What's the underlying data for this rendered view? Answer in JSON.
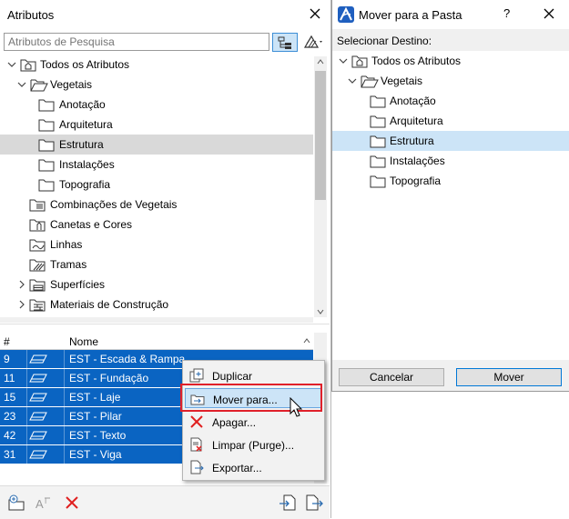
{
  "left_panel": {
    "title": "Atributos",
    "search": {
      "placeholder": "Atributos de Pesquisa",
      "value": ""
    },
    "tree": [
      {
        "label": "Todos os Atributos",
        "depth": 0,
        "expanded": true,
        "icon": "home-folder-icon"
      },
      {
        "label": "Vegetais",
        "depth": 1,
        "expanded": true,
        "icon": "open-folder-icon"
      },
      {
        "label": "Anotação",
        "depth": 2,
        "icon": "folder-icon"
      },
      {
        "label": "Arquitetura",
        "depth": 2,
        "icon": "folder-icon"
      },
      {
        "label": "Estrutura",
        "depth": 2,
        "icon": "folder-icon",
        "selected": true
      },
      {
        "label": "Instalações",
        "depth": 2,
        "icon": "folder-icon"
      },
      {
        "label": "Topografia",
        "depth": 2,
        "icon": "folder-icon"
      },
      {
        "label": "Combinações de Vegetais",
        "depth": 1,
        "icon": "layer-combination-icon"
      },
      {
        "label": "Canetas e Cores",
        "depth": 1,
        "icon": "pens-icon"
      },
      {
        "label": "Linhas",
        "depth": 1,
        "icon": "line-types-icon"
      },
      {
        "label": "Tramas",
        "depth": 1,
        "icon": "fills-icon"
      },
      {
        "label": "Superfícies",
        "depth": 1,
        "collapsed": true,
        "icon": "surfaces-icon"
      },
      {
        "label": "Materiais de Construção",
        "depth": 1,
        "collapsed": true,
        "icon": "building-materials-icon"
      }
    ],
    "list": {
      "columns": [
        "#",
        "Nome"
      ],
      "rows": [
        {
          "num": "9",
          "name": "EST - Escada & Rampa"
        },
        {
          "num": "11",
          "name": "EST - Fundação"
        },
        {
          "num": "15",
          "name": "EST - Laje"
        },
        {
          "num": "23",
          "name": "EST - Pilar"
        },
        {
          "num": "42",
          "name": "EST - Texto"
        },
        {
          "num": "31",
          "name": "EST - Viga"
        }
      ]
    },
    "toolbar": [
      "new-folder-icon",
      "rename-icon",
      "delete-icon",
      "import-icon",
      "export-icon"
    ]
  },
  "context_menu": {
    "items": [
      {
        "label": "Duplicar",
        "icon": "duplicate-icon"
      },
      {
        "label": "Mover para...",
        "icon": "move-to-icon",
        "highlighted": true
      },
      {
        "label": "Apagar...",
        "icon": "delete-icon"
      },
      {
        "label": "Limpar (Purge)...",
        "icon": "purge-icon"
      },
      {
        "label": "Exportar...",
        "icon": "export-icon"
      }
    ]
  },
  "dialog": {
    "title": "Mover para a Pasta",
    "help": "?",
    "subtitle": "Selecionar Destino:",
    "tree": [
      {
        "label": "Todos os Atributos",
        "depth": 0,
        "icon": "home-folder-icon"
      },
      {
        "label": "Vegetais",
        "depth": 1,
        "icon": "open-folder-icon"
      },
      {
        "label": "Anotação",
        "depth": 2,
        "icon": "folder-icon"
      },
      {
        "label": "Arquitetura",
        "depth": 2,
        "icon": "folder-icon"
      },
      {
        "label": "Estrutura",
        "depth": 2,
        "icon": "folder-icon",
        "selected": true
      },
      {
        "label": "Instalações",
        "depth": 2,
        "icon": "folder-icon"
      },
      {
        "label": "Topografia",
        "depth": 2,
        "icon": "folder-icon"
      }
    ],
    "cancel_label": "Cancelar",
    "ok_label": "Mover"
  },
  "colors": {
    "selection_blue": "#0a64c2",
    "highlight_blue": "#cce4f7",
    "red_outline": "#e0202a"
  }
}
